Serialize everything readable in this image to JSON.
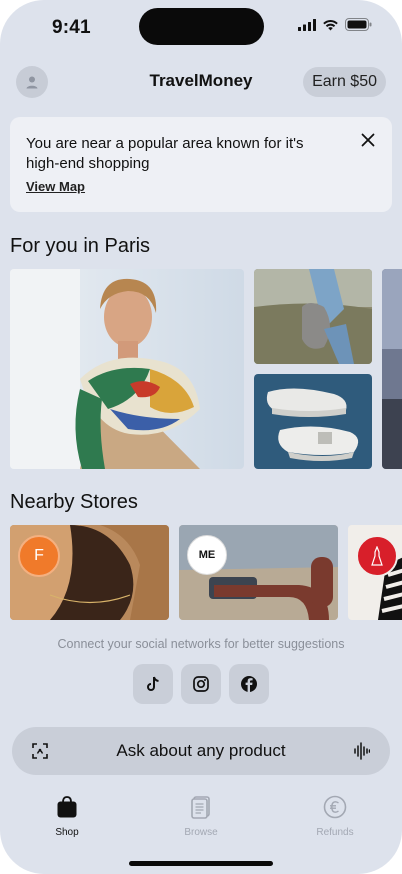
{
  "status_bar": {
    "time": "9:41"
  },
  "header": {
    "title": "TravelMoney",
    "earn_label": "Earn $50"
  },
  "banner": {
    "message": "You are near a popular area known for it's high-end shopping",
    "link_label": "View Map"
  },
  "for_you": {
    "title": "For you in Paris",
    "cards": [
      {
        "name": "scarf-model"
      },
      {
        "name": "handbag"
      },
      {
        "name": "sneakers"
      },
      {
        "name": "partial-card"
      }
    ]
  },
  "nearby": {
    "title": "Nearby Stores",
    "stores": [
      {
        "logo_text": "F",
        "accent": "#f07a2a"
      },
      {
        "logo_text": "ME",
        "accent": "#ffffff"
      },
      {
        "logo_text": "",
        "accent": "#d81f2a"
      }
    ]
  },
  "social": {
    "caption": "Connect your social networks for better suggestions",
    "networks": [
      "tiktok-icon",
      "instagram-icon",
      "facebook-icon"
    ]
  },
  "ask": {
    "placeholder": "Ask about any product"
  },
  "tabs": [
    {
      "label": "Shop",
      "active": true
    },
    {
      "label": "Browse",
      "active": false
    },
    {
      "label": "Refunds",
      "active": false
    }
  ],
  "colors": {
    "background": "#dde2ec",
    "chip": "#c9ced8",
    "inactive_tab": "#a3a8b3",
    "active_tab": "#111111"
  }
}
